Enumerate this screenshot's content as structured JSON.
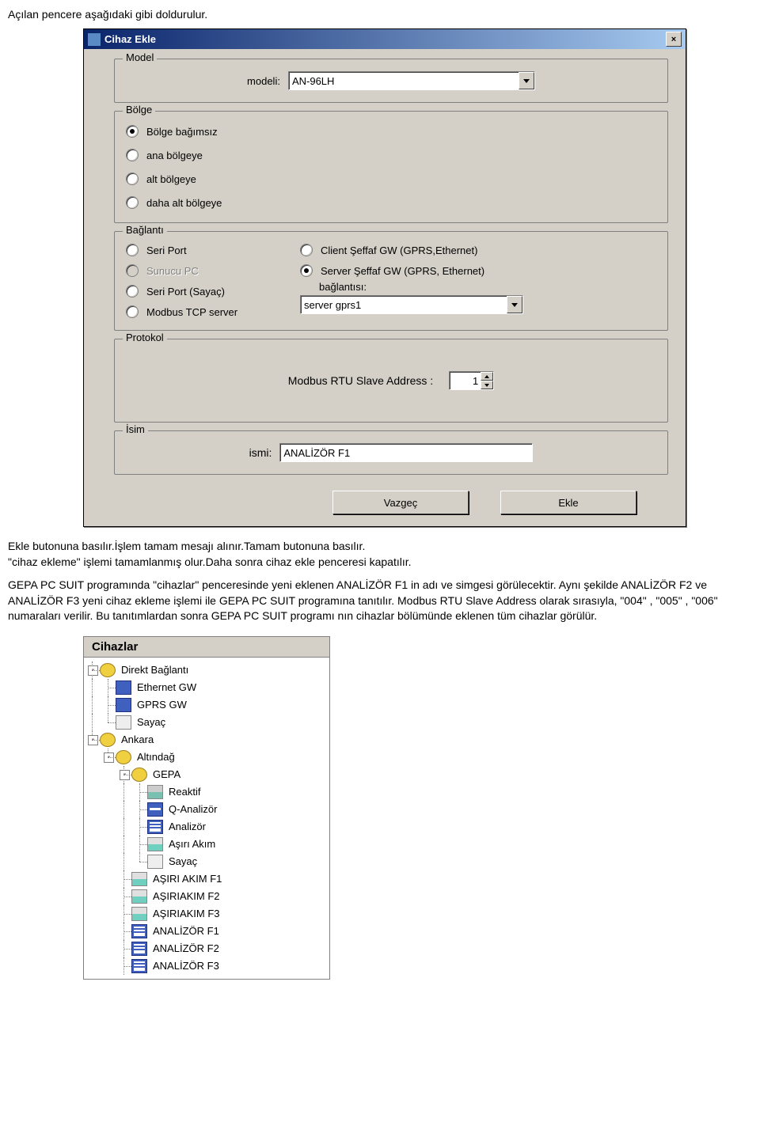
{
  "intro": "Açılan pencere aşağıdaki gibi doldurulur.",
  "dialog": {
    "title": "Cihaz Ekle",
    "close": "×",
    "model": {
      "legend": "Model",
      "label": "modeli:",
      "value": "AN-96LH"
    },
    "bolge": {
      "legend": "Bölge",
      "options": [
        "Bölge bağımsız",
        "ana bölgeye",
        "alt bölgeye",
        "daha alt bölgeye"
      ]
    },
    "baglanti": {
      "legend": "Bağlantı",
      "left": [
        "Seri Port",
        "Sunucu PC",
        "Seri Port (Sayaç)",
        "Modbus TCP server"
      ],
      "right": [
        "Client Şeffaf GW (GPRS,Ethernet)",
        "Server Şeffaf GW (GPRS, Ethernet)"
      ],
      "baglantisi_label": "bağlantısı:",
      "baglantisi_value": "server gprs1"
    },
    "protokol": {
      "legend": "Protokol",
      "label": "Modbus RTU Slave Address :",
      "value": "1"
    },
    "isim": {
      "legend": "İsim",
      "label": "ismi:",
      "value": "ANALİZÖR F1"
    },
    "buttons": {
      "cancel": "Vazgeç",
      "ok": "Ekle"
    }
  },
  "body_text": "Ekle butonuna basılır.İşlem tamam mesajı alınır.Tamam butonuna basılır.\n\"cihaz ekleme\" işlemi tamamlanmış olur.Daha sonra cihaz ekle penceresi kapatılır.\n\nGEPA PC SUIT programında \"cihazlar\" penceresinde yeni eklenen ANALİZÖR F1 in adı ve simgesi görülecektir. Aynı şekilde ANALİZÖR F2 ve ANALİZÖR F3 yeni cihaz ekleme işlemi ile GEPA PC SUIT programına tanıtılır. Modbus RTU Slave Address olarak sırasıyla, \"004\" ,  \"005\"  ,  \"006\" numaraları verilir. Bu tanıtımlardan sonra GEPA PC SUIT programı nın cihazlar bölümünde eklenen tüm cihazlar görülür.",
  "tree": {
    "header": "Cihazlar",
    "nodes": [
      {
        "level": 0,
        "conn": "teefirst",
        "expander": "-",
        "icon": "folder",
        "label": "Direkt Bağlantı"
      },
      {
        "level": 1,
        "pre": [
          "vline"
        ],
        "conn": "tee",
        "icon": "eth",
        "label": "Ethernet GW"
      },
      {
        "level": 1,
        "pre": [
          "vline"
        ],
        "conn": "tee",
        "icon": "gprs",
        "label": "GPRS GW"
      },
      {
        "level": 1,
        "pre": [
          "vline"
        ],
        "conn": "last",
        "icon": "sayac",
        "label": "Sayaç"
      },
      {
        "level": 0,
        "conn": "last",
        "expander": "-",
        "icon": "folder",
        "label": "Ankara"
      },
      {
        "level": 1,
        "pre": [
          "blank"
        ],
        "conn": "last",
        "expander": "-",
        "icon": "folder",
        "label": "Altındağ"
      },
      {
        "level": 2,
        "pre": [
          "blank",
          "blank"
        ],
        "conn": "tee",
        "expander": "-",
        "icon": "folder",
        "label": "GEPA"
      },
      {
        "level": 3,
        "pre": [
          "blank",
          "blank",
          "vline"
        ],
        "conn": "tee",
        "icon": "reaktif",
        "label": "Reaktif"
      },
      {
        "level": 3,
        "pre": [
          "blank",
          "blank",
          "vline"
        ],
        "conn": "tee",
        "icon": "qanaliz",
        "label": "Q-Analizör"
      },
      {
        "level": 3,
        "pre": [
          "blank",
          "blank",
          "vline"
        ],
        "conn": "tee",
        "icon": "analiz",
        "label": "Analizör"
      },
      {
        "level": 3,
        "pre": [
          "blank",
          "blank",
          "vline"
        ],
        "conn": "tee",
        "icon": "asiri",
        "label": "Aşırı Akım"
      },
      {
        "level": 3,
        "pre": [
          "blank",
          "blank",
          "vline"
        ],
        "conn": "last",
        "icon": "sayac",
        "label": "Sayaç"
      },
      {
        "level": 2,
        "pre": [
          "blank",
          "blank"
        ],
        "conn": "tee",
        "icon": "asiri",
        "label": "AŞIRI AKIM F1"
      },
      {
        "level": 2,
        "pre": [
          "blank",
          "blank"
        ],
        "conn": "tee",
        "icon": "asiri",
        "label": "AŞIRIAKIM F2"
      },
      {
        "level": 2,
        "pre": [
          "blank",
          "blank"
        ],
        "conn": "tee",
        "icon": "asiri",
        "label": "AŞIRIAKIM F3"
      },
      {
        "level": 2,
        "pre": [
          "blank",
          "blank"
        ],
        "conn": "tee",
        "icon": "analiz",
        "label": "ANALİZÖR F1"
      },
      {
        "level": 2,
        "pre": [
          "blank",
          "blank"
        ],
        "conn": "tee",
        "icon": "analiz",
        "label": "ANALİZÖR F2"
      },
      {
        "level": 2,
        "pre": [
          "blank",
          "blank"
        ],
        "conn": "tee",
        "icon": "analiz",
        "label": "ANALİZÖR F3"
      }
    ]
  }
}
